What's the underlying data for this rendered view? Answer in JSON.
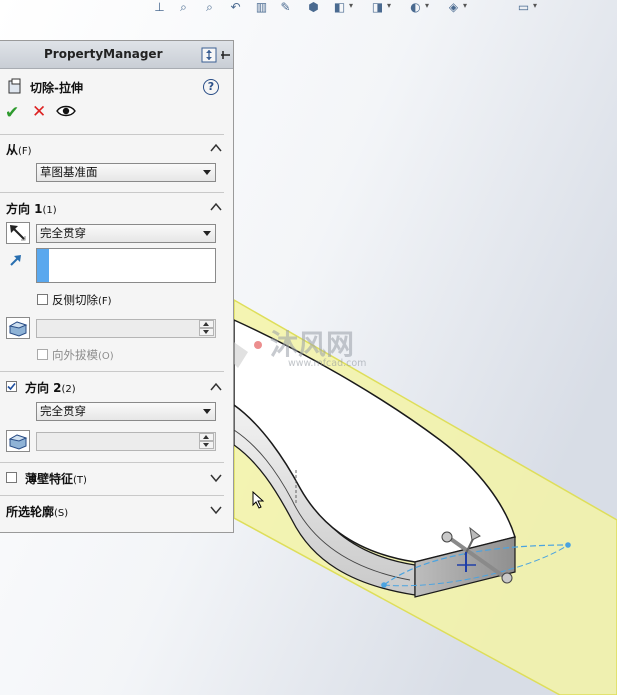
{
  "toolbar": {
    "icons": [
      {
        "name": "view-orientation-icon",
        "glyph": "⊥"
      },
      {
        "name": "zoom-to-fit-icon",
        "glyph": "⌕"
      },
      {
        "name": "zoom-to-area-icon",
        "glyph": "⌕"
      },
      {
        "name": "previous-view-icon",
        "glyph": "↶"
      },
      {
        "name": "section-view-icon",
        "glyph": "▥"
      },
      {
        "name": "dynamic-annotation-icon",
        "glyph": "✎"
      },
      {
        "name": "view-orientation-cube-icon",
        "glyph": "⬢"
      },
      {
        "name": "display-style-icon",
        "glyph": "◧"
      },
      {
        "name": "hide-show-items-icon",
        "glyph": "◨"
      },
      {
        "name": "edit-appearance-icon",
        "glyph": "◐"
      },
      {
        "name": "apply-scene-icon",
        "glyph": "◈"
      },
      {
        "name": "view-settings-icon",
        "glyph": "▭"
      }
    ]
  },
  "property_manager": {
    "header_title": "PropertyManager",
    "feature_title": "切除-拉伸",
    "help_glyph": "?",
    "ok_glyph": "✔",
    "cancel_glyph": "✕"
  },
  "from_section": {
    "label": "从",
    "key": "(F)",
    "value": "草图基准面"
  },
  "direction1": {
    "label": "方向 1",
    "key": "(1)",
    "end_condition": "完全贯穿",
    "flip_side_label": "反侧切除",
    "flip_side_key": "(F)",
    "flip_side_checked": false,
    "draft_outward_label": "向外拔模",
    "draft_outward_key": "(O)",
    "draft_outward_checked": false
  },
  "direction2": {
    "label": "方向 2",
    "key": "(2)",
    "checked": true,
    "end_condition": "完全贯穿"
  },
  "thin_feature": {
    "label": "薄壁特征",
    "key": "(T)",
    "checked": false
  },
  "selected_contours": {
    "label": "所选轮廓",
    "key": "(S)"
  },
  "watermark": {
    "brand": "沐风网",
    "url": "www.mfcad.com"
  },
  "colors": {
    "model_face": "#ffffff",
    "model_edge": "#1a1a1a",
    "plane_fill": "#f3f3a6",
    "plane_edge": "#dede5a",
    "accent_blue": "#4aa3e0",
    "pm_background": "#f5f5f5"
  }
}
